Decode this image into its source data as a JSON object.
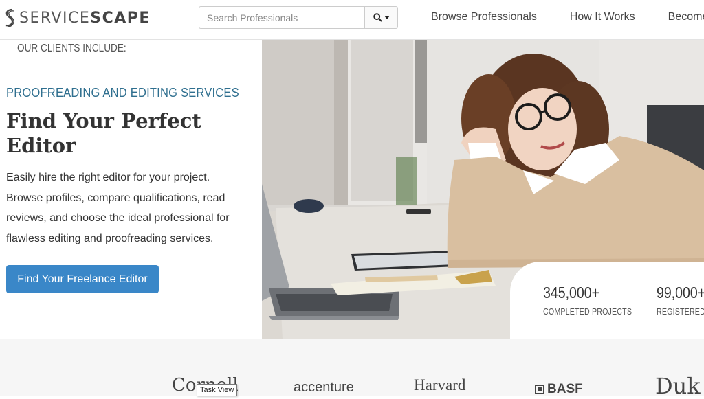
{
  "header": {
    "logo_text_light": "SERVICE",
    "logo_text_bold": "SCAPE",
    "search": {
      "placeholder": "Search Professionals"
    },
    "nav": [
      "Browse Professionals",
      "How It Works",
      "Become"
    ]
  },
  "hero": {
    "eyebrow": "PROOFREADING AND EDITING SERVICES",
    "title": "Find Your Perfect Editor",
    "description": "Easily hire the right editor for your project. Browse profiles, compare qualifications, read reviews, and choose the ideal professional for flawless editing and proofreading services.",
    "cta_label": "Find Your Freelance Editor"
  },
  "stats": [
    {
      "value": "345,000+",
      "label": "COMPLETED PROJECTS"
    },
    {
      "value": "99,000+",
      "label": "REGISTERED C"
    }
  ],
  "clients": {
    "label": "OUR CLIENTS INCLUDE:",
    "logos": [
      "Cornell",
      "accenture",
      "Harvard",
      "BASF",
      "Duk"
    ]
  },
  "tooltip": "Task View",
  "colors": {
    "accent": "#3a87c8",
    "eyebrow": "#2f6f8f",
    "sweater": "#d9bfa0"
  }
}
